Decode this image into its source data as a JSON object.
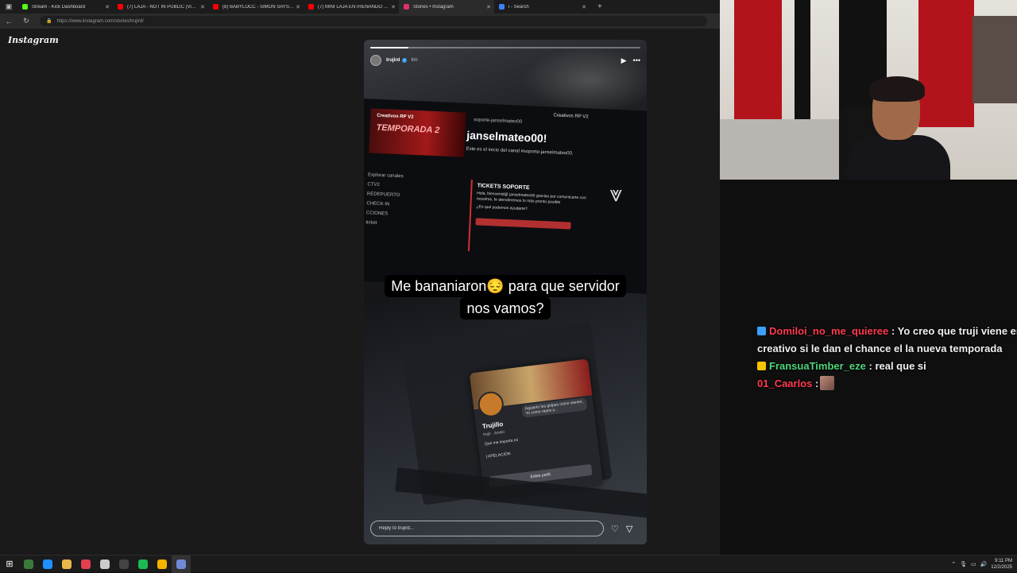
{
  "browser": {
    "tabs": [
      {
        "title": "Stream - Kick Dashboard",
        "icon": "kick-icon",
        "color": "#53fc18",
        "active": false
      },
      {
        "title": "(7) LAJA - NOT IN PUBLIC (Video",
        "icon": "youtube-icon",
        "color": "#ff0000",
        "active": false
      },
      {
        "title": "(8) BABYLOCC - SIMON SAYS (M",
        "icon": "youtube-icon",
        "color": "#ff0000",
        "active": false
      },
      {
        "title": "(7) MINI LAJA ENTRENANDO PA",
        "icon": "youtube-icon",
        "color": "#ff0000",
        "active": false
      },
      {
        "title": "Stories • Instagram",
        "icon": "instagram-icon",
        "color": "#e1306c",
        "active": true
      },
      {
        "title": "i - Search",
        "icon": "search-icon",
        "color": "#3b82f6",
        "active": false
      }
    ],
    "url": "https://www.instagram.com/stories/trujird/"
  },
  "instagram": {
    "logo": "Instagram",
    "story": {
      "username": "trujird",
      "time": "8m",
      "progress": 0.14,
      "caption_line1": "Me bananiaron😔 para que servidor",
      "caption_line2": "nos vamos?",
      "reply_placeholder": "Reply to trujird...",
      "screenshot": {
        "server": "Creativos RP V2",
        "banner_top": "Creativos RP V2",
        "banner_main": "TEMPORADA 2",
        "channel_title": "janselmateo00!",
        "channel_name": "soporte-janselmateo00",
        "channel_sub": "Este es el inicio del canal #soporte-janselmateo00.",
        "side_items": [
          "Explorar canales",
          "CTV2",
          "REDEPUERTO",
          "CHECK-IN",
          "CCIONES",
          "ticket"
        ],
        "ticket_title": "TICKETS SOPORTE",
        "ticket_text": "Hola, bienvenid@ janselmateo00 gracias por comunicarte con nosotros, te atenderemos lo más pronto posible",
        "ticket_q": "¿En qué podemos ayudarte?",
        "profile_name": "Trujillo",
        "profile_handle": "trujir · Amén",
        "profile_status": "Aguanto los golpes como vienen, Yo como rayos y...",
        "profile_bio": "Que me importa mi",
        "profile_appeal": "| APELACIÓN",
        "profile_edit": "Editar perfil"
      }
    }
  },
  "chat": [
    {
      "user": "Domiloi_no_me_quieree",
      "user_color": "#ff3b4e",
      "badge_color": "#3aa0ff",
      "message": ": Yo creo que truji viene en"
    },
    {
      "user": "",
      "user_color": "#f0f0f0",
      "badge_color": "",
      "message": "creativo si le dan el chance el la nueva temporada"
    },
    {
      "user": "FransuaTimber_eze",
      "user_color": "#4fd67a",
      "badge_color": "#f5c400",
      "message": ": real que si"
    },
    {
      "user": "01_Caarlos",
      "user_color": "#ff3b4e",
      "badge_color": "",
      "message": ":",
      "emote": true
    }
  ],
  "taskbar": {
    "apps": [
      {
        "icon": "terminal-icon",
        "color": "#3a7a3a"
      },
      {
        "icon": "edge-icon",
        "color": "#1e90ff"
      },
      {
        "icon": "file-explorer-icon",
        "color": "#e8b84a"
      },
      {
        "icon": "valorant-icon",
        "color": "#e04050"
      },
      {
        "icon": "pen-icon",
        "color": "#cccccc"
      },
      {
        "icon": "obs-icon",
        "color": "#444444"
      },
      {
        "icon": "spotify-icon",
        "color": "#1db954"
      },
      {
        "icon": "chrome-icon",
        "color": "#f4b400"
      },
      {
        "icon": "discord-icon",
        "color": "#7289da"
      }
    ],
    "time": "9:11 PM",
    "date": "12/2/2025"
  }
}
